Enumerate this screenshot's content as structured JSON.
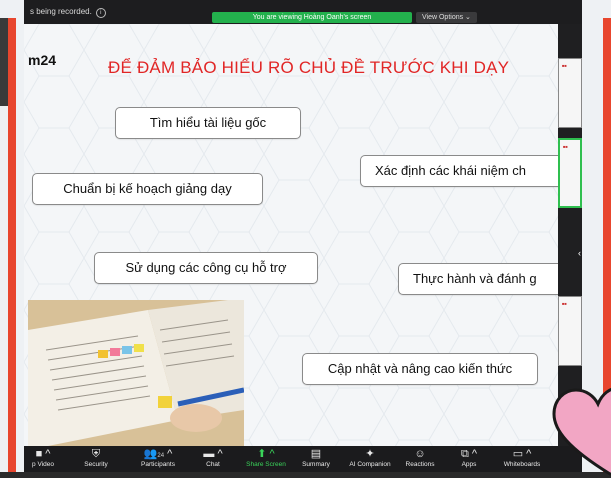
{
  "recording": {
    "text": "s being recorded."
  },
  "banner": {
    "viewing": "You are viewing Hoàng Oanh's screen",
    "view_options": "View Options ⌄"
  },
  "slide": {
    "logo": "m24",
    "title": "ĐỂ ĐẢM BẢO HIỂU RÕ CHỦ ĐỀ TRƯỚC KHI DẠY",
    "boxes": [
      "Tìm hiểu tài liệu gốc",
      "Xác định các khái niệm ch",
      "Chuẩn bị kế hoạch giảng dạy",
      "Sử dụng các công cụ hỗ trợ",
      "Thực hành và đánh g",
      "Cập nhật và nâng cao kiến thức"
    ]
  },
  "toolbar": {
    "items": [
      {
        "label": "p Video",
        "icon": "video-camera-icon"
      },
      {
        "label": "Security",
        "icon": "shield-icon"
      },
      {
        "label": "Participants",
        "icon": "participants-icon",
        "count": "24"
      },
      {
        "label": "Chat",
        "icon": "chat-icon"
      },
      {
        "label": "Share Screen",
        "icon": "share-screen-icon"
      },
      {
        "label": "Summary",
        "icon": "summary-icon"
      },
      {
        "label": "AI Companion",
        "icon": "sparkle-icon"
      },
      {
        "label": "Reactions",
        "icon": "reactions-icon"
      },
      {
        "label": "Apps",
        "icon": "apps-icon"
      },
      {
        "label": "Whiteboards",
        "icon": "whiteboard-icon"
      }
    ]
  },
  "colors": {
    "accent_green": "#23b14d",
    "title_red": "#e12626",
    "side_red": "#e8462e",
    "heart_pink": "#f2a6c4"
  }
}
